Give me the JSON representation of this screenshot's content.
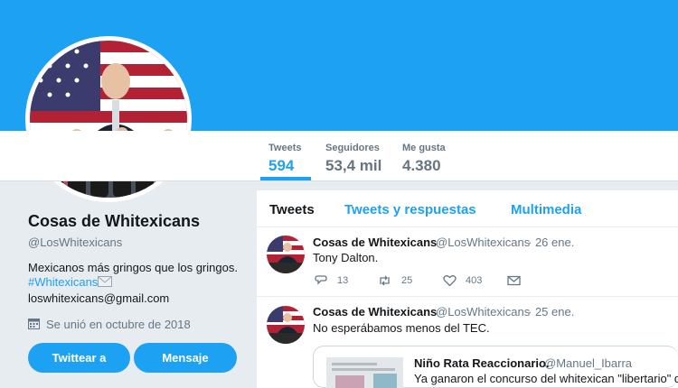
{
  "profile": {
    "name": "Cosas de Whitexicans",
    "handle": "@LosWhitexicans",
    "bio": "Mexicanos más gringos que los gringos.",
    "hashtag": "#Whitexicans",
    "email": "loswhitexicans@gmail.com",
    "joined": "Se unió en octubre de 2018",
    "tweet_to_label": "Twittear a",
    "message_label": "Mensaje"
  },
  "stats": [
    {
      "label": "Tweets",
      "value": "594"
    },
    {
      "label": "Seguidores",
      "value": "53,4 mil"
    },
    {
      "label": "Me gusta",
      "value": "4.380"
    }
  ],
  "tabs": [
    "Tweets",
    "Tweets y respuestas",
    "Multimedia"
  ],
  "tweets": [
    {
      "name": "Cosas de Whitexicans",
      "handle": "@LosWhitexicans",
      "date": "· 26 ene.",
      "text": "Tony Dalton.",
      "replies": "13",
      "retweets": "25",
      "likes": "403"
    },
    {
      "name": "Cosas de Whitexicans",
      "handle": "@LosWhitexicans",
      "date": "· 25 ene.",
      "text": "No esperábamos menos del TEC.",
      "quote": {
        "name": "Niño Rata Reaccionario.",
        "handle": "@Manuel_Ibarra",
        "text": "Ya ganaron el concurso del whitexican \"libertario\" de"
      }
    }
  ],
  "colors": {
    "accent": "#1da1f2",
    "text": "#14171a",
    "muted": "#657786"
  }
}
